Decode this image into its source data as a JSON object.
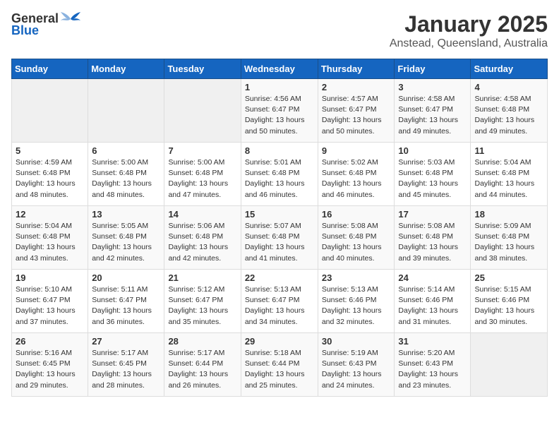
{
  "header": {
    "logo_general": "General",
    "logo_blue": "Blue",
    "title": "January 2025",
    "subtitle": "Anstead, Queensland, Australia"
  },
  "weekdays": [
    "Sunday",
    "Monday",
    "Tuesday",
    "Wednesday",
    "Thursday",
    "Friday",
    "Saturday"
  ],
  "weeks": [
    [
      {
        "day": "",
        "sunrise": "",
        "sunset": "",
        "daylight": ""
      },
      {
        "day": "",
        "sunrise": "",
        "sunset": "",
        "daylight": ""
      },
      {
        "day": "",
        "sunrise": "",
        "sunset": "",
        "daylight": ""
      },
      {
        "day": "1",
        "sunrise": "Sunrise: 4:56 AM",
        "sunset": "Sunset: 6:47 PM",
        "daylight": "Daylight: 13 hours and 50 minutes."
      },
      {
        "day": "2",
        "sunrise": "Sunrise: 4:57 AM",
        "sunset": "Sunset: 6:47 PM",
        "daylight": "Daylight: 13 hours and 50 minutes."
      },
      {
        "day": "3",
        "sunrise": "Sunrise: 4:58 AM",
        "sunset": "Sunset: 6:47 PM",
        "daylight": "Daylight: 13 hours and 49 minutes."
      },
      {
        "day": "4",
        "sunrise": "Sunrise: 4:58 AM",
        "sunset": "Sunset: 6:48 PM",
        "daylight": "Daylight: 13 hours and 49 minutes."
      }
    ],
    [
      {
        "day": "5",
        "sunrise": "Sunrise: 4:59 AM",
        "sunset": "Sunset: 6:48 PM",
        "daylight": "Daylight: 13 hours and 48 minutes."
      },
      {
        "day": "6",
        "sunrise": "Sunrise: 5:00 AM",
        "sunset": "Sunset: 6:48 PM",
        "daylight": "Daylight: 13 hours and 48 minutes."
      },
      {
        "day": "7",
        "sunrise": "Sunrise: 5:00 AM",
        "sunset": "Sunset: 6:48 PM",
        "daylight": "Daylight: 13 hours and 47 minutes."
      },
      {
        "day": "8",
        "sunrise": "Sunrise: 5:01 AM",
        "sunset": "Sunset: 6:48 PM",
        "daylight": "Daylight: 13 hours and 46 minutes."
      },
      {
        "day": "9",
        "sunrise": "Sunrise: 5:02 AM",
        "sunset": "Sunset: 6:48 PM",
        "daylight": "Daylight: 13 hours and 46 minutes."
      },
      {
        "day": "10",
        "sunrise": "Sunrise: 5:03 AM",
        "sunset": "Sunset: 6:48 PM",
        "daylight": "Daylight: 13 hours and 45 minutes."
      },
      {
        "day": "11",
        "sunrise": "Sunrise: 5:04 AM",
        "sunset": "Sunset: 6:48 PM",
        "daylight": "Daylight: 13 hours and 44 minutes."
      }
    ],
    [
      {
        "day": "12",
        "sunrise": "Sunrise: 5:04 AM",
        "sunset": "Sunset: 6:48 PM",
        "daylight": "Daylight: 13 hours and 43 minutes."
      },
      {
        "day": "13",
        "sunrise": "Sunrise: 5:05 AM",
        "sunset": "Sunset: 6:48 PM",
        "daylight": "Daylight: 13 hours and 42 minutes."
      },
      {
        "day": "14",
        "sunrise": "Sunrise: 5:06 AM",
        "sunset": "Sunset: 6:48 PM",
        "daylight": "Daylight: 13 hours and 42 minutes."
      },
      {
        "day": "15",
        "sunrise": "Sunrise: 5:07 AM",
        "sunset": "Sunset: 6:48 PM",
        "daylight": "Daylight: 13 hours and 41 minutes."
      },
      {
        "day": "16",
        "sunrise": "Sunrise: 5:08 AM",
        "sunset": "Sunset: 6:48 PM",
        "daylight": "Daylight: 13 hours and 40 minutes."
      },
      {
        "day": "17",
        "sunrise": "Sunrise: 5:08 AM",
        "sunset": "Sunset: 6:48 PM",
        "daylight": "Daylight: 13 hours and 39 minutes."
      },
      {
        "day": "18",
        "sunrise": "Sunrise: 5:09 AM",
        "sunset": "Sunset: 6:48 PM",
        "daylight": "Daylight: 13 hours and 38 minutes."
      }
    ],
    [
      {
        "day": "19",
        "sunrise": "Sunrise: 5:10 AM",
        "sunset": "Sunset: 6:47 PM",
        "daylight": "Daylight: 13 hours and 37 minutes."
      },
      {
        "day": "20",
        "sunrise": "Sunrise: 5:11 AM",
        "sunset": "Sunset: 6:47 PM",
        "daylight": "Daylight: 13 hours and 36 minutes."
      },
      {
        "day": "21",
        "sunrise": "Sunrise: 5:12 AM",
        "sunset": "Sunset: 6:47 PM",
        "daylight": "Daylight: 13 hours and 35 minutes."
      },
      {
        "day": "22",
        "sunrise": "Sunrise: 5:13 AM",
        "sunset": "Sunset: 6:47 PM",
        "daylight": "Daylight: 13 hours and 34 minutes."
      },
      {
        "day": "23",
        "sunrise": "Sunrise: 5:13 AM",
        "sunset": "Sunset: 6:46 PM",
        "daylight": "Daylight: 13 hours and 32 minutes."
      },
      {
        "day": "24",
        "sunrise": "Sunrise: 5:14 AM",
        "sunset": "Sunset: 6:46 PM",
        "daylight": "Daylight: 13 hours and 31 minutes."
      },
      {
        "day": "25",
        "sunrise": "Sunrise: 5:15 AM",
        "sunset": "Sunset: 6:46 PM",
        "daylight": "Daylight: 13 hours and 30 minutes."
      }
    ],
    [
      {
        "day": "26",
        "sunrise": "Sunrise: 5:16 AM",
        "sunset": "Sunset: 6:45 PM",
        "daylight": "Daylight: 13 hours and 29 minutes."
      },
      {
        "day": "27",
        "sunrise": "Sunrise: 5:17 AM",
        "sunset": "Sunset: 6:45 PM",
        "daylight": "Daylight: 13 hours and 28 minutes."
      },
      {
        "day": "28",
        "sunrise": "Sunrise: 5:17 AM",
        "sunset": "Sunset: 6:44 PM",
        "daylight": "Daylight: 13 hours and 26 minutes."
      },
      {
        "day": "29",
        "sunrise": "Sunrise: 5:18 AM",
        "sunset": "Sunset: 6:44 PM",
        "daylight": "Daylight: 13 hours and 25 minutes."
      },
      {
        "day": "30",
        "sunrise": "Sunrise: 5:19 AM",
        "sunset": "Sunset: 6:43 PM",
        "daylight": "Daylight: 13 hours and 24 minutes."
      },
      {
        "day": "31",
        "sunrise": "Sunrise: 5:20 AM",
        "sunset": "Sunset: 6:43 PM",
        "daylight": "Daylight: 13 hours and 23 minutes."
      },
      {
        "day": "",
        "sunrise": "",
        "sunset": "",
        "daylight": ""
      }
    ]
  ]
}
